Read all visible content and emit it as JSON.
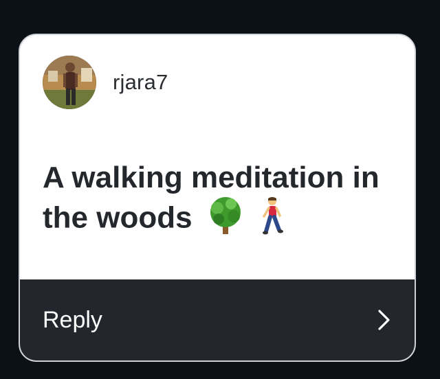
{
  "user": {
    "username": "rjara7",
    "avatar_icon": "profile-photo"
  },
  "message": {
    "text": "A walking meditation in the woods",
    "emojis": [
      "tree-icon",
      "walking-person-icon"
    ]
  },
  "footer": {
    "reply_label": "Reply",
    "chevron_icon": "chevron-right-icon"
  },
  "colors": {
    "background": "#0c1117",
    "card": "#ffffff",
    "footer": "#23272d",
    "text": "#24282d"
  }
}
